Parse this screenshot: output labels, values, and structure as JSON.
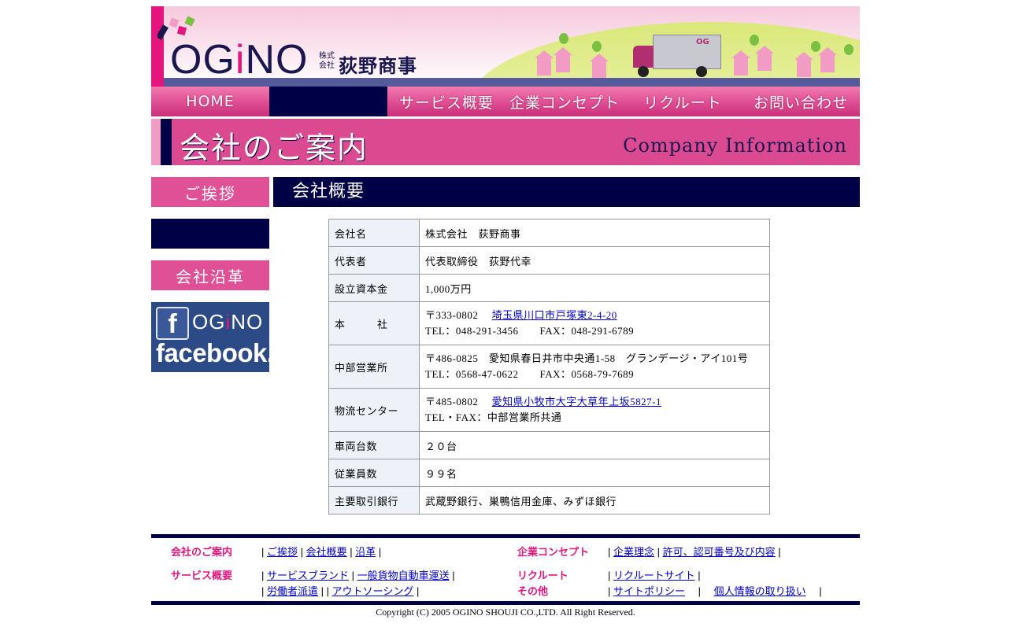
{
  "header": {
    "logo": "OGiNO",
    "company_prefix": "株式会社",
    "company_name": "荻野商事",
    "truck_mark": "OG"
  },
  "nav": {
    "home": "HOME",
    "service": "サービス概要",
    "concept": "企業コンセプト",
    "recruit": "リクルート",
    "contact": "お問い合わせ"
  },
  "page_title": {
    "jp": "会社のご案内",
    "en": "Company Information"
  },
  "sidebar": {
    "greeting": "ご挨拶",
    "history": "会社沿革",
    "facebook_logo": "OGiNO",
    "facebook_word": "facebook."
  },
  "section_title": "会社概要",
  "table": {
    "company_name_label": "会社名",
    "company_name_value": "株式会社　荻野商事",
    "rep_label": "代表者",
    "rep_value": "代表取締役　荻野代幸",
    "capital_label": "設立資本金",
    "capital_value": "1,000万円",
    "hq_label": "本　　　社",
    "hq_zip": "〒333-0802",
    "hq_address": "埼玉県川口市戸塚東2-4-20",
    "hq_tel": "TEL：048-291-3456　　FAX：048-291-6789",
    "chubu_label": "中部営業所",
    "chubu_address": "〒486-0825　愛知県春日井市中央通1-58　グランデージ・アイ101号",
    "chubu_tel": "TEL：0568-47-0622　　FAX：0568-79-7689",
    "logi_label": "物流センター",
    "logi_zip": "〒485-0802",
    "logi_address": "愛知県小牧市大字大草年上坂5827-1",
    "logi_tel": "TEL・FAX：中部営業所共通",
    "vehicles_label": "車両台数",
    "vehicles_value": "２０台",
    "employees_label": "従業員数",
    "employees_value": "９９名",
    "bank_label": "主要取引銀行",
    "bank_value": "武蔵野銀行、巣鴨信用金庫、みずほ銀行"
  },
  "footer": {
    "cat_company": "会社のご案内",
    "link_greeting": "ご挨拶",
    "link_overview": "会社概要",
    "link_history": "沿革",
    "cat_concept": "企業コンセプト",
    "link_philosophy": "企業理念",
    "link_license": "許可、認可番号及び内容",
    "cat_service": "サービス概要",
    "link_brand": "サービスブランド",
    "link_freight": "一般貨物自動車運送",
    "link_dispatch": "労働者派遣",
    "link_outsourcing": "アウトソーシング",
    "cat_recruit": "リクルート",
    "link_recruit_site": "リクルートサイト",
    "cat_other": "その他",
    "link_policy": "サイトポリシー",
    "link_privacy": "個人情報の取り扱い",
    "copyright": "Copyright (C) 2005 OGINO SHOUJI CO.,LTD. All Right Reserved."
  },
  "colors": {
    "navy": "#000046",
    "pink": "#df4d93",
    "magenta": "#e5157e",
    "link": "#0000cc"
  }
}
